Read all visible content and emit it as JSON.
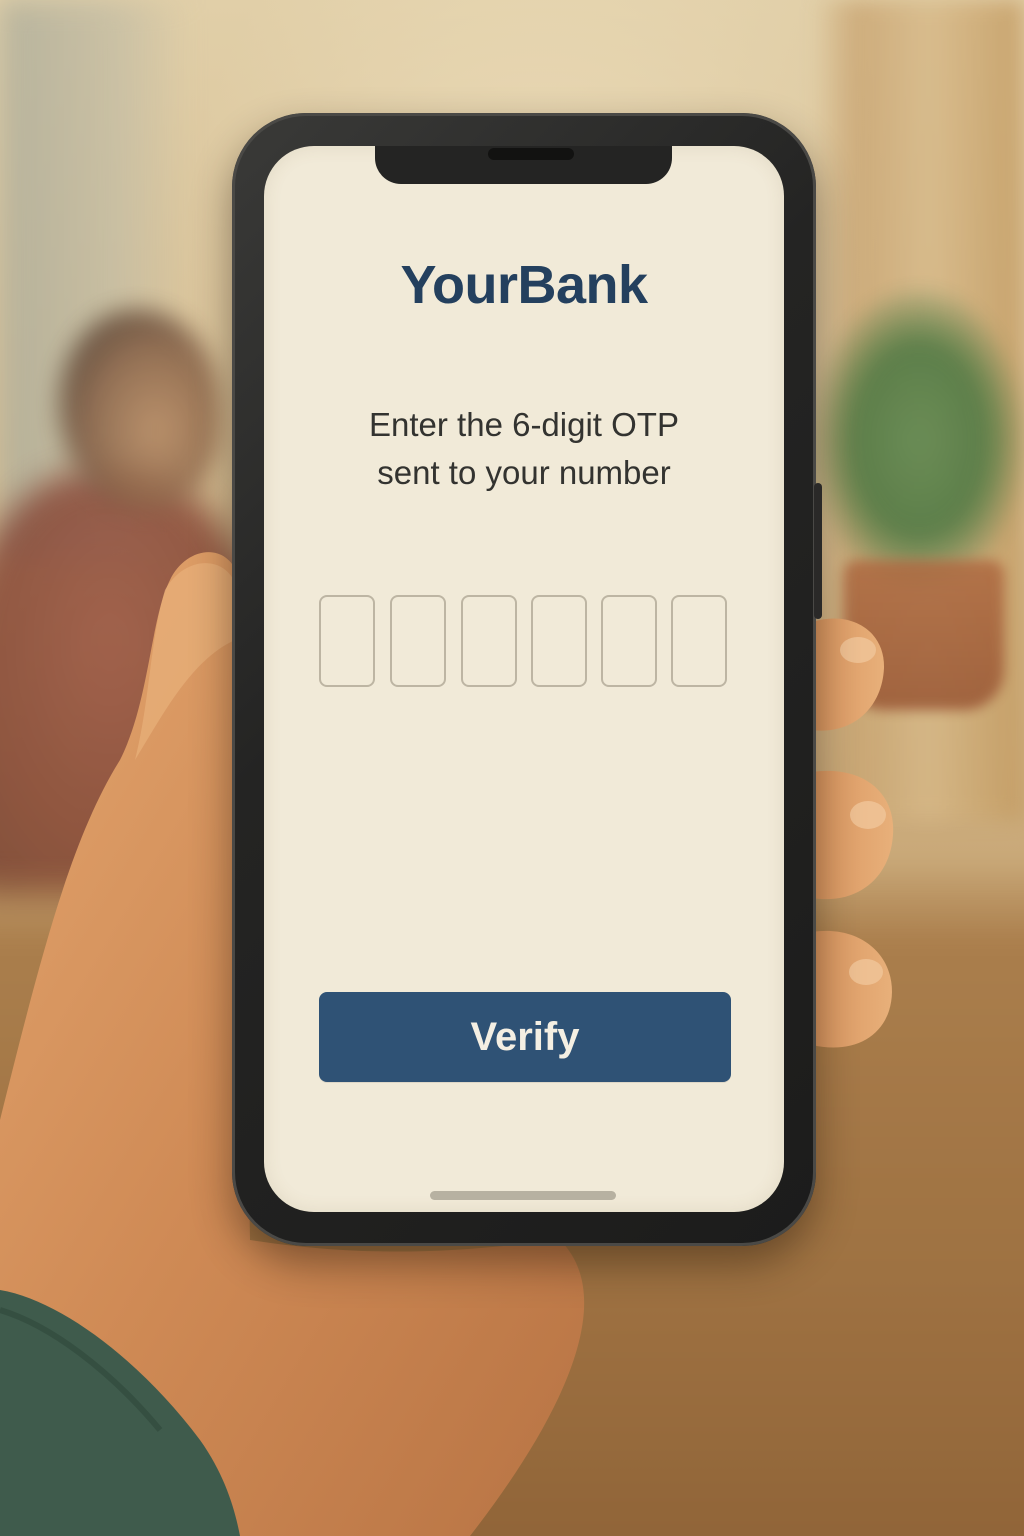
{
  "app": {
    "brand_name": "YourBank"
  },
  "otp_screen": {
    "prompt_line1": "Enter the 6-digit OTP",
    "prompt_line2": "sent to your number",
    "otp_digits": [
      "",
      "",
      "",
      "",
      "",
      ""
    ],
    "verify_label": "Verify"
  },
  "colors": {
    "brand_text": "#24405e",
    "button_background": "#2f5275",
    "button_text": "#f4efe3",
    "screen_background": "#f1ead8",
    "otp_border": "#bdb5a3"
  }
}
